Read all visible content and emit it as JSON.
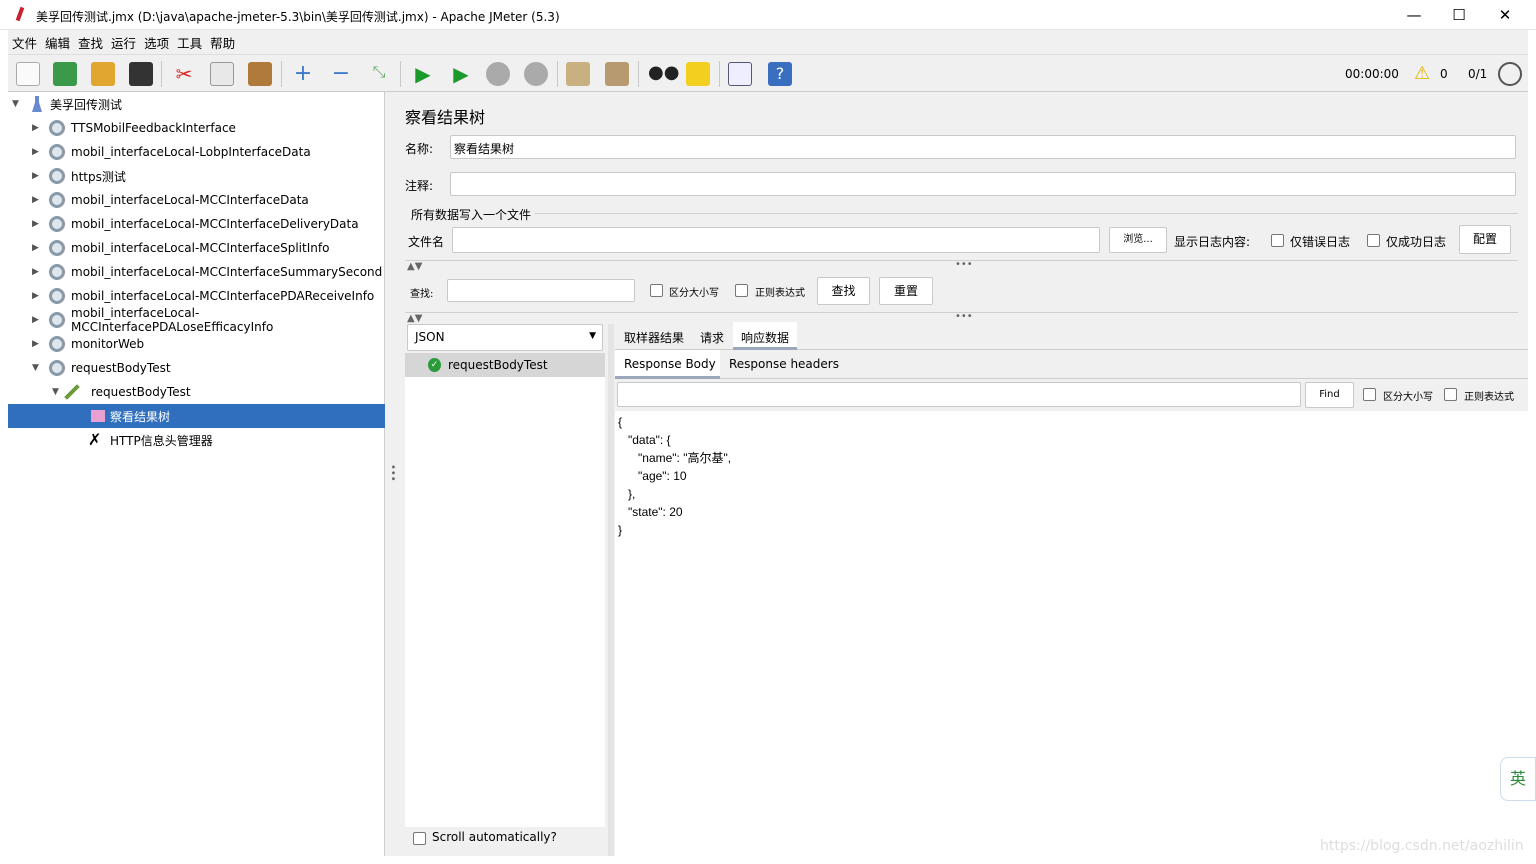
{
  "window": {
    "title": "美孚回传测试.jmx (D:\\java\\apache-jmeter-5.3\\bin\\美孚回传测试.jmx) - Apache JMeter (5.3)",
    "minimize": "—",
    "maximize": "☐",
    "close": "✕"
  },
  "menu": [
    "文件",
    "编辑",
    "查找",
    "运行",
    "选项",
    "工具",
    "帮助"
  ],
  "toolbar": {
    "timer": "00:00:00",
    "warnings": "0",
    "threads": "0/1",
    "icons": [
      "new-icon",
      "templates-icon",
      "open-icon",
      "save-icon",
      "cut-icon",
      "copy-icon",
      "paste-icon",
      "expand-icon",
      "collapse-icon",
      "toggle-icon",
      "start-icon",
      "start-no-pause-icon",
      "stop-icon",
      "shutdown-icon",
      "clear-icon",
      "clear-all-icon",
      "search-icon",
      "reset-search-icon",
      "function-helper-icon",
      "help-icon"
    ]
  },
  "tree": {
    "root": "美孚回传测试",
    "items": [
      "TTSMobilFeedbackInterface",
      "mobil_interfaceLocal-LobpInterfaceData",
      "https测试",
      "mobil_interfaceLocal-MCCInterfaceData",
      "mobil_interfaceLocal-MCCInterfaceDeliveryData",
      "mobil_interfaceLocal-MCCInterfaceSplitInfo",
      "mobil_interfaceLocal-MCCInterfaceSummarySecond",
      "mobil_interfaceLocal-MCCInterfacePDAReceiveInfo",
      "mobil_interfaceLocal-MCCInterfacePDALoseEfficacyInfo",
      "monitorWeb",
      "requestBodyTest"
    ],
    "sampler": "requestBodyTest",
    "selected": "察看结果树",
    "header_manager": "HTTP信息头管理器"
  },
  "panel": {
    "title": "察看结果树",
    "name_label": "名称:",
    "name_value": "察看结果树",
    "comment_label": "注释:",
    "comment_value": "",
    "file_group": "所有数据写入一个文件",
    "file_label": "文件名",
    "file_value": "",
    "browse": "浏览...",
    "log_label": "显示日志内容:",
    "errors_only": "仅错误日志",
    "success_only": "仅成功日志",
    "configure": "配置",
    "search_label": "查找:",
    "search_value": "",
    "case_sensitive": "区分大小写",
    "regex": "正则表达式",
    "find": "查找",
    "reset": "重置",
    "renderer": "JSON",
    "result_item": "requestBodyTest",
    "scroll_auto": "Scroll automatically?",
    "tabs": [
      "取样器结果",
      "请求",
      "响应数据"
    ],
    "active_tab": "响应数据",
    "subtabs": [
      "Response Body",
      "Response headers"
    ],
    "active_subtab": "Response Body",
    "body_find": "Find",
    "body_case": "区分大小写",
    "body_regex": "正则表达式",
    "body": "{\n   \"data\": {\n      \"name\": \"高尔基\",\n      \"age\": 10\n   },\n   \"state\": 20\n}"
  },
  "ime": "英",
  "watermark": "https://blog.csdn.net/aozhilin"
}
